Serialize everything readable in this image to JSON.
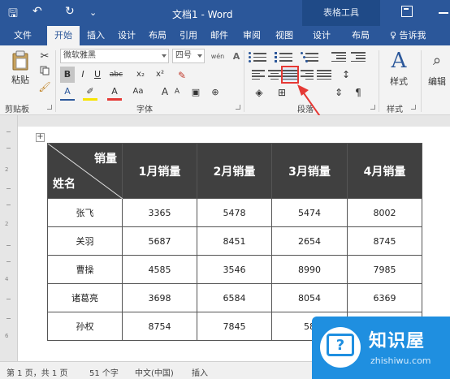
{
  "titlebar": {
    "doc_title": "文档1 - Word",
    "context_tab": "表格工具",
    "save_glyph": "🖫",
    "undo_glyph": "↶",
    "redo_glyph": "↻",
    "customize_glyph": "⌄"
  },
  "tabs": [
    {
      "label": "文件"
    },
    {
      "label": "开始"
    },
    {
      "label": "插入"
    },
    {
      "label": "设计"
    },
    {
      "label": "布局"
    },
    {
      "label": "引用"
    },
    {
      "label": "邮件"
    },
    {
      "label": "审阅"
    },
    {
      "label": "视图"
    },
    {
      "label": "设计"
    },
    {
      "label": "布局"
    }
  ],
  "help": "♀ 告诉我",
  "ribbon": {
    "paste_label": "粘贴",
    "clipboard_label": "剪贴板",
    "font_group_label": "字体",
    "paragraph_group_label": "段落",
    "styles_group_label": "样式",
    "styles_button_label": "样式",
    "editing_button_label": "编辑",
    "font_name": "微软雅黑",
    "font_size": "四号",
    "wen_glyph": "wén",
    "bold": "B",
    "italic": "I",
    "underline": "U",
    "strike": "abc",
    "subscript": "x₂",
    "superscript": "x²",
    "font_grow": "A",
    "font_shrink": "A",
    "change_case": "Aa",
    "char_shade": "A"
  },
  "table": {
    "header_top": "销量",
    "header_bottom": "姓名",
    "columns": [
      "1月销量",
      "2月销量",
      "3月销量",
      "4月销量"
    ],
    "rows": [
      {
        "name": "张飞",
        "values": [
          "3365",
          "5478",
          "5474",
          "8002"
        ]
      },
      {
        "name": "关羽",
        "values": [
          "5687",
          "8451",
          "2654",
          "8745"
        ]
      },
      {
        "name": "曹操",
        "values": [
          "4585",
          "3546",
          "8990",
          "7985"
        ]
      },
      {
        "name": "诸葛亮",
        "values": [
          "3698",
          "6584",
          "8054",
          "6369"
        ]
      },
      {
        "name": "孙权",
        "values": [
          "8754",
          "7845",
          "58",
          ""
        ]
      }
    ]
  },
  "statusbar": {
    "page": "第 1 页，共 1 页",
    "words": "51 个字",
    "language": "中文(中国)",
    "mode": "插入"
  },
  "badge": {
    "brand": "知识屋",
    "domain": "zhishiwu.com"
  },
  "colors": {
    "title_blue": "#2b579a",
    "header_fill": "#404040",
    "highlight_red": "#e53935",
    "badge_blue": "#1f8fe0"
  }
}
